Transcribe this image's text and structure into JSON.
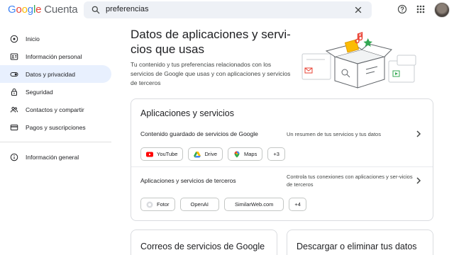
{
  "header": {
    "logo_google": "Google",
    "logo_product": "Cuenta",
    "search_value": "preferencias"
  },
  "sidebar": {
    "items": [
      {
        "label": "Inicio",
        "icon": "home-icon"
      },
      {
        "label": "Información personal",
        "icon": "id-card-icon"
      },
      {
        "label": "Datos y privacidad",
        "icon": "toggle-icon",
        "active": true
      },
      {
        "label": "Seguridad",
        "icon": "lock-icon"
      },
      {
        "label": "Contactos y compartir",
        "icon": "people-icon"
      },
      {
        "label": "Pagos y suscripciones",
        "icon": "credit-card-icon"
      }
    ],
    "general": {
      "label": "Información general",
      "icon": "info-icon"
    }
  },
  "main": {
    "title": "Datos de aplicaciones y servi-cios que usas",
    "title_line1": "Datos de aplicaciones y servi-",
    "title_line2": "cios que usas",
    "description": "Tu contenido y tus preferencias relacionados con los servicios de Google que usas y con aplicaciones y servicios de terceros"
  },
  "apps_card": {
    "title": "Aplicaciones y servicios",
    "google_row": {
      "label": "Contenido guardado de servicios de Google",
      "description": "Un resumen de tus servicios y tus datos",
      "chips": [
        "YouTube",
        "Drive",
        "Maps",
        "+3"
      ]
    },
    "third_party_row": {
      "label": "Aplicaciones y servicios de terceros",
      "description": "Controla tus conexiones con aplicaciones y ser-vicios de terceros",
      "chips": [
        "Fotor",
        "OpenAI",
        "SimilarWeb.com",
        "+4"
      ]
    }
  },
  "bottom_cards": {
    "email": "Correos de servicios de Google",
    "download": "Descargar o eliminar tus datos"
  },
  "colors": {
    "accent": "#1a73e8",
    "active_nav_bg": "#e8f0fe",
    "border": "#dadce0"
  }
}
